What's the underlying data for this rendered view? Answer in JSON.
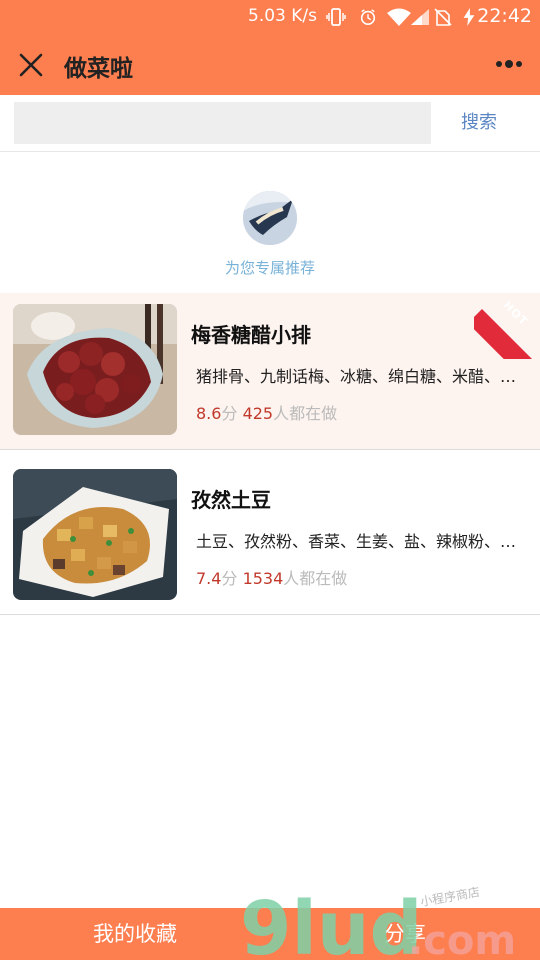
{
  "status_bar": {
    "speed": "5.03 K/s",
    "time": "22:42"
  },
  "header": {
    "title": "做菜啦"
  },
  "search": {
    "placeholder": "",
    "button_label": "搜索"
  },
  "recommend": {
    "label": "为您专属推荐"
  },
  "recipes": [
    {
      "name": "梅香糖醋小排",
      "ingredients": "猪排骨、九制话梅、冰糖、绵白糖、米醋、…",
      "score": "8.6",
      "score_unit": "分",
      "count": "425",
      "count_suffix": "人都在做",
      "hot_label": "HOT"
    },
    {
      "name": "孜然土豆",
      "ingredients": "土豆、孜然粉、香菜、生姜、盐、辣椒粉、…",
      "score": "7.4",
      "score_unit": "分",
      "count": "1534",
      "count_suffix": "人都在做"
    }
  ],
  "bottom_bar": {
    "favorites_label": "我的收藏",
    "share_label": "分享"
  },
  "watermark": {
    "logo_text": "9lud.com",
    "tagline": "小程序商店"
  },
  "colors": {
    "header_bg": "#fd7e4f",
    "accent_red": "#c1392b",
    "link_blue": "#5b86c3",
    "hot_red": "#e22b3a"
  },
  "icons": [
    "close-icon",
    "more-icon",
    "vibrate-icon",
    "alarm-icon",
    "wifi-icon",
    "signal-icon",
    "charging-icon"
  ]
}
